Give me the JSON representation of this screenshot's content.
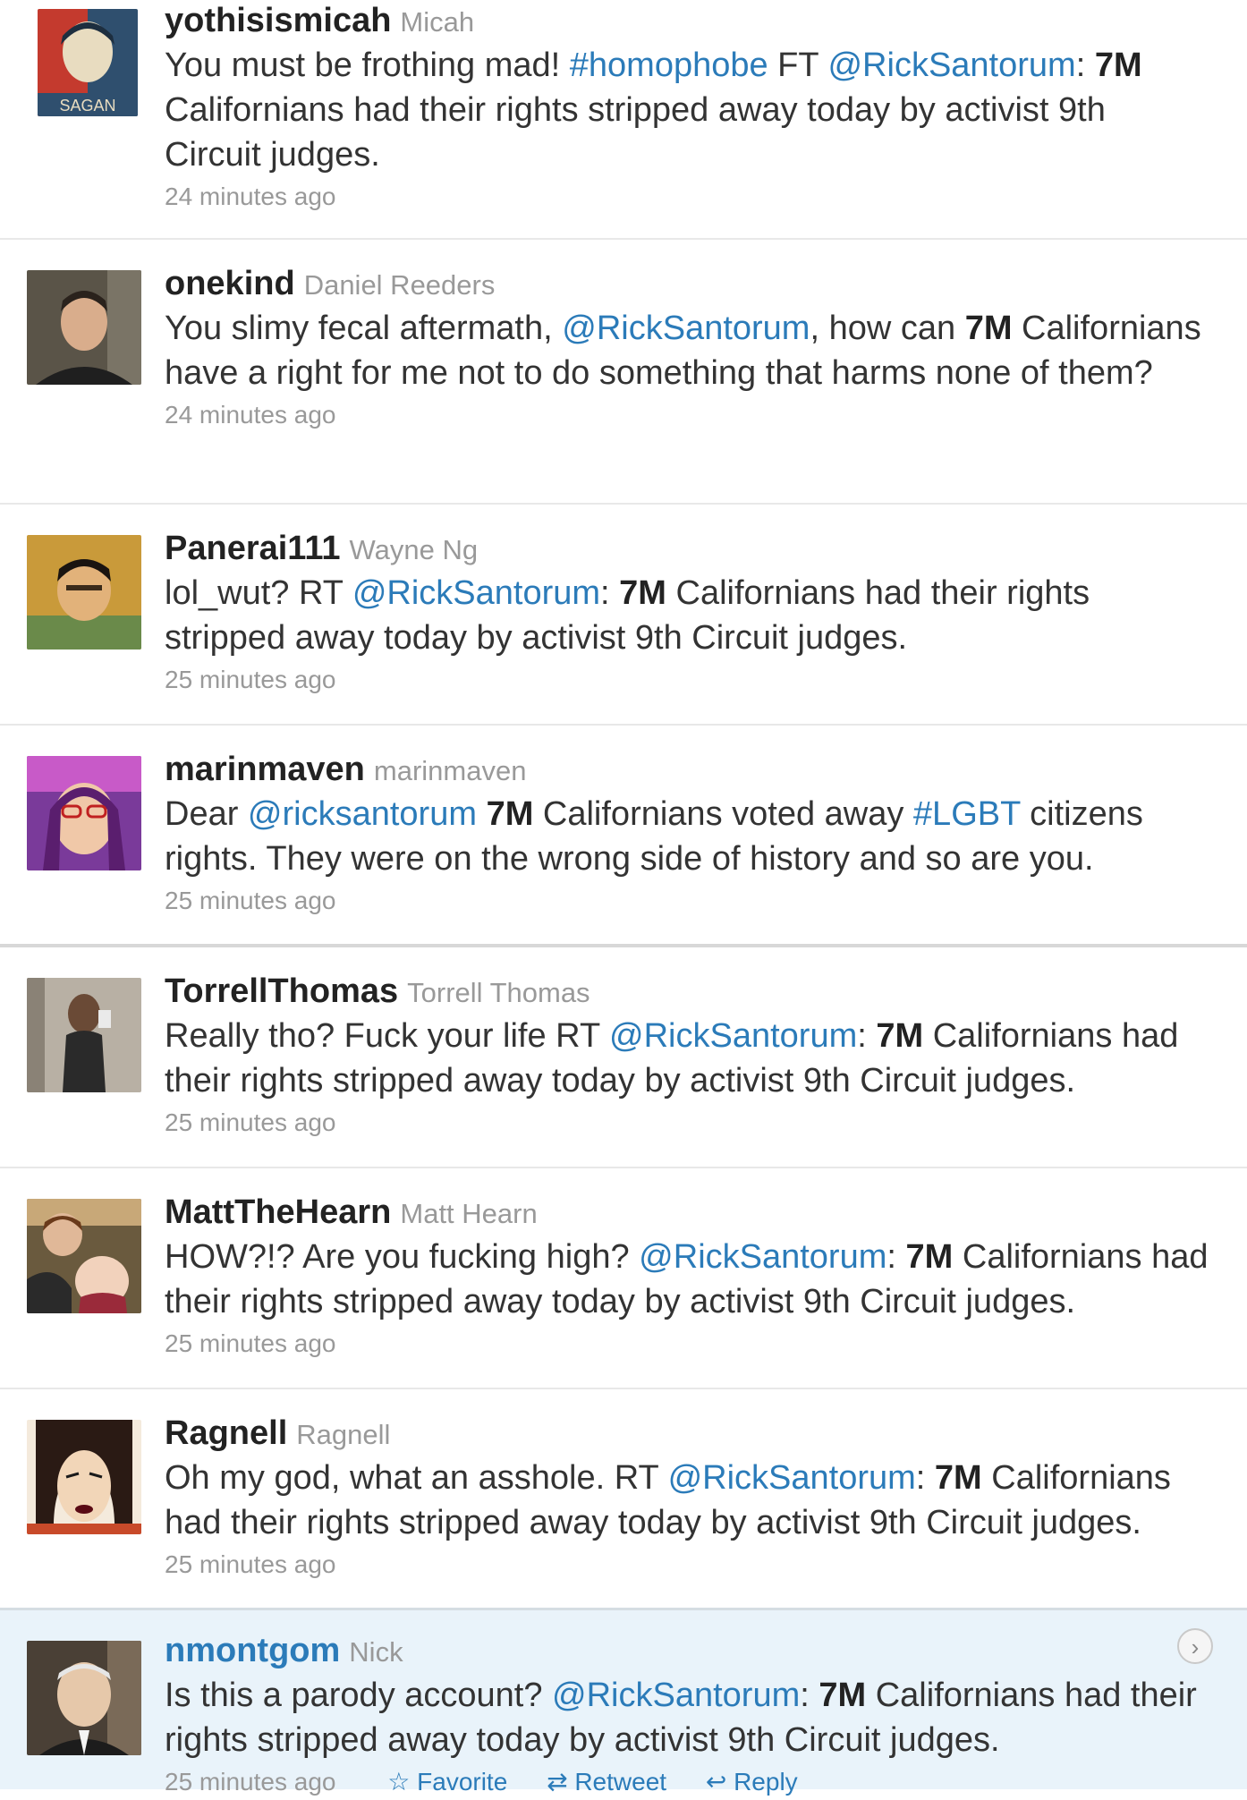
{
  "tweets": [
    {
      "username": "yothisismicah",
      "fullname": "Micah",
      "avatar_text": "SAGAN",
      "parts": [
        {
          "t": "text",
          "v": "You must be frothing mad! "
        },
        {
          "t": "hashtag",
          "v": "#homophobe"
        },
        {
          "t": "text",
          "v": " FT "
        },
        {
          "t": "mention",
          "v": "@RickSantorum"
        },
        {
          "t": "text",
          "v": ": "
        },
        {
          "t": "bold",
          "v": "7M"
        },
        {
          "t": "text",
          "v": " Californians had their rights stripped away today by activist 9th Circuit judges."
        }
      ],
      "time": "24 minutes ago"
    },
    {
      "username": "onekind",
      "fullname": "Daniel Reeders",
      "parts": [
        {
          "t": "text",
          "v": "You slimy fecal aftermath, "
        },
        {
          "t": "mention",
          "v": "@RickSantorum"
        },
        {
          "t": "text",
          "v": ", how can "
        },
        {
          "t": "bold",
          "v": "7M"
        },
        {
          "t": "text",
          "v": " Californians have a right for me not to do something that harms none of them?"
        }
      ],
      "time": "24 minutes ago"
    },
    {
      "username": "Panerai111",
      "fullname": "Wayne Ng",
      "parts": [
        {
          "t": "text",
          "v": "lol_wut? RT "
        },
        {
          "t": "mention",
          "v": "@RickSantorum"
        },
        {
          "t": "text",
          "v": ": "
        },
        {
          "t": "bold",
          "v": "7M"
        },
        {
          "t": "text",
          "v": " Californians had their rights stripped away today by activist 9th Circuit judges."
        }
      ],
      "time": "25 minutes ago"
    },
    {
      "username": "marinmaven",
      "fullname": "marinmaven",
      "parts": [
        {
          "t": "text",
          "v": "Dear "
        },
        {
          "t": "mention",
          "v": "@ricksantorum"
        },
        {
          "t": "text",
          "v": " "
        },
        {
          "t": "bold",
          "v": "7M"
        },
        {
          "t": "text",
          "v": " Californians voted away "
        },
        {
          "t": "hashtag",
          "v": "#LGBT"
        },
        {
          "t": "text",
          "v": " citizens rights. They were on the wrong side of history and so are you."
        }
      ],
      "time": "25 minutes ago"
    },
    {
      "username": "TorrellThomas",
      "fullname": "Torrell Thomas",
      "parts": [
        {
          "t": "text",
          "v": "Really tho? Fuck your life RT "
        },
        {
          "t": "mention",
          "v": "@RickSantorum"
        },
        {
          "t": "text",
          "v": ": "
        },
        {
          "t": "bold",
          "v": "7M"
        },
        {
          "t": "text",
          "v": " Californians had their rights stripped away today by activist 9th Circuit judges."
        }
      ],
      "time": "25 minutes ago"
    },
    {
      "username": "MattTheHearn",
      "fullname": "Matt Hearn",
      "parts": [
        {
          "t": "text",
          "v": "HOW?!? Are you fucking high? "
        },
        {
          "t": "mention",
          "v": "@RickSantorum"
        },
        {
          "t": "text",
          "v": ": "
        },
        {
          "t": "bold",
          "v": "7M"
        },
        {
          "t": "text",
          "v": " Californians had their rights stripped away today by activist 9th Circuit judges."
        }
      ],
      "time": "25 minutes ago"
    },
    {
      "username": "Ragnell",
      "fullname": "Ragnell",
      "parts": [
        {
          "t": "text",
          "v": "Oh my god, what an asshole. RT "
        },
        {
          "t": "mention",
          "v": "@RickSantorum"
        },
        {
          "t": "text",
          "v": ": "
        },
        {
          "t": "bold",
          "v": "7M"
        },
        {
          "t": "text",
          "v": " Californians had their rights stripped away today by activist 9th Circuit judges."
        }
      ],
      "time": "25 minutes ago"
    },
    {
      "username": "nmontgom",
      "fullname": "Nick",
      "parts": [
        {
          "t": "text",
          "v": "Is this a parody account? "
        },
        {
          "t": "mention",
          "v": "@RickSantorum"
        },
        {
          "t": "text",
          "v": ": "
        },
        {
          "t": "bold",
          "v": "7M"
        },
        {
          "t": "text",
          "v": " Californians had their rights stripped away today by activist 9th Circuit judges."
        }
      ],
      "time": "25 minutes ago",
      "actions": {
        "favorite": "Favorite",
        "retweet": "Retweet",
        "reply": "Reply"
      },
      "expand_icon": "chevron-right-icon"
    }
  ],
  "colors": {
    "link": "#2b7bb9",
    "selected_bg": "#e9f3fa",
    "muted": "#999999"
  }
}
